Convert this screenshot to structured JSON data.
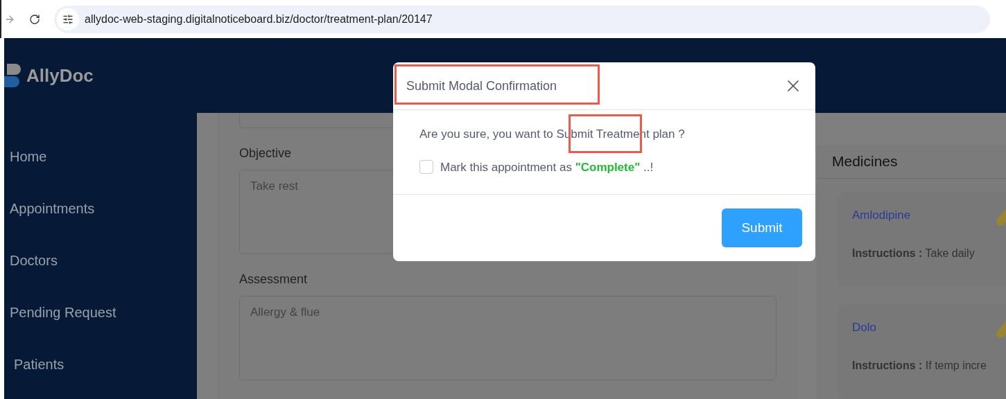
{
  "browser": {
    "url": "allydoc-web-staging.digitalnoticeboard.biz/doctor/treatment-plan/20147"
  },
  "app": {
    "logo": "AllyDoc"
  },
  "sidebar": {
    "items": [
      {
        "label": "Home"
      },
      {
        "label": "Appointments"
      },
      {
        "label": "Doctors"
      },
      {
        "label": "Pending Request"
      },
      {
        "label": "Patients"
      }
    ]
  },
  "form": {
    "fields": [
      {
        "label": "Objective",
        "value": "Take rest"
      },
      {
        "label": "Assessment",
        "value": "Allergy & flue"
      }
    ]
  },
  "medicines": {
    "title": "Medicines",
    "items": [
      {
        "name": "Amlodipine",
        "instructions_label": "Instructions :",
        "instructions": "Take daily"
      },
      {
        "name": "Dolo",
        "instructions_label": "Instructions :",
        "instructions": "If temp incre"
      }
    ]
  },
  "modal": {
    "title": "Submit Modal Confirmation",
    "message": "Are you sure, you want to Submit Treatment plan ?",
    "checkbox": {
      "label": "Mark this appointment as **\"Complete\"** ..!",
      "checked": false
    },
    "submit": "Submit"
  }
}
